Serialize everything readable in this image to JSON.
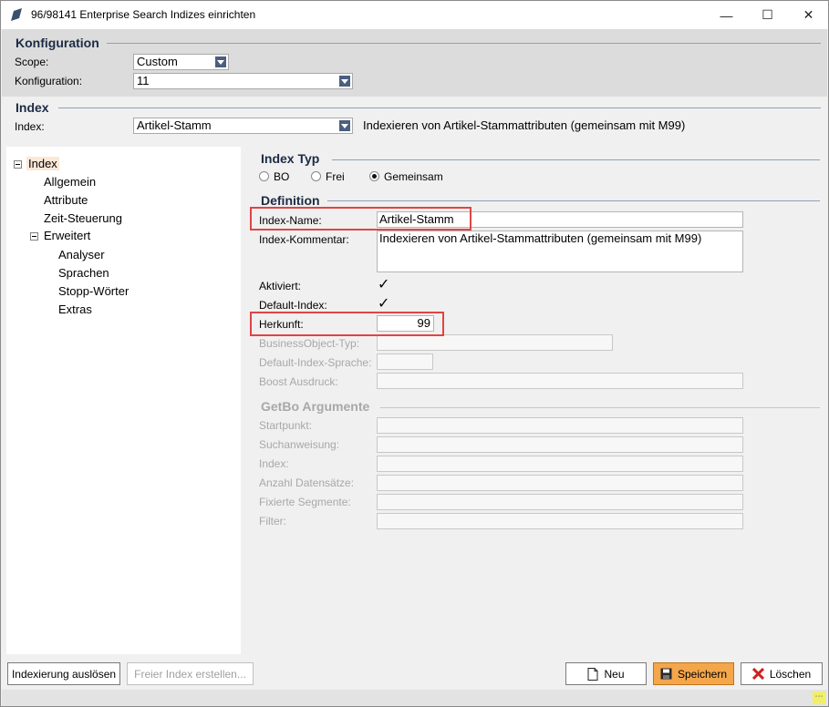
{
  "window": {
    "title": "96/98141 Enterprise Search Indizes einrichten",
    "minimize_glyph": "—",
    "maximize_glyph": "☐",
    "close_glyph": "✕"
  },
  "konfiguration": {
    "header": "Konfiguration",
    "scope_label": "Scope:",
    "scope_value": "Custom",
    "konfiguration_label": "Konfiguration:",
    "konfiguration_value": "11"
  },
  "index": {
    "header": "Index",
    "index_label": "Index:",
    "index_value": "Artikel-Stamm",
    "index_description": "Indexieren von Artikel-Stammattributen (gemeinsam mit M99)"
  },
  "tree": {
    "items": [
      {
        "label": "Index"
      },
      {
        "label": "Allgemein"
      },
      {
        "label": "Attribute"
      },
      {
        "label": "Zeit-Steuerung"
      },
      {
        "label": "Erweitert"
      },
      {
        "label": "Analyser"
      },
      {
        "label": "Sprachen"
      },
      {
        "label": "Stopp-Wörter"
      },
      {
        "label": "Extras"
      }
    ]
  },
  "index_typ": {
    "header": "Index Typ",
    "options": [
      "BO",
      "Frei",
      "Gemeinsam"
    ],
    "selected": "Gemeinsam"
  },
  "definition": {
    "header": "Definition",
    "index_name_label": "Index-Name:",
    "index_name_value": "Artikel-Stamm",
    "kommentar_label": "Index-Kommentar:",
    "kommentar_value": "Indexieren von Artikel-Stammattributen (gemeinsam mit M99)",
    "aktiviert_label": "Aktiviert:",
    "aktiviert_checked": true,
    "default_index_label": "Default-Index:",
    "default_index_checked": true,
    "herkunft_label": "Herkunft:",
    "herkunft_value": "99",
    "bo_typ_label": "BusinessObject-Typ:",
    "bo_typ_value": "",
    "default_sprache_label": "Default-Index-Sprache:",
    "default_sprache_value": "",
    "boost_label": "Boost Ausdruck:",
    "boost_value": "",
    "check_glyph": "✓"
  },
  "getbo": {
    "header": "GetBo Argumente",
    "startpunkt_label": "Startpunkt:",
    "suchanweisung_label": "Suchanweisung:",
    "index_label": "Index:",
    "anzahl_label": "Anzahl Datensätze:",
    "fixierte_label": "Fixierte Segmente:",
    "filter_label": "Filter:"
  },
  "buttons": {
    "indexierung": "Indexierung auslösen",
    "freier_index": "Freier Index erstellen...",
    "neu": "Neu",
    "speichern": "Speichern",
    "loeschen": "Löschen"
  },
  "status": {
    "grip_glyph": "⋯"
  },
  "colors": {
    "accent_header": "#1c2b44",
    "highlight_box": "#e14444",
    "primary_button": "#f4a64a",
    "tree_selection": "#fbe8d6"
  }
}
